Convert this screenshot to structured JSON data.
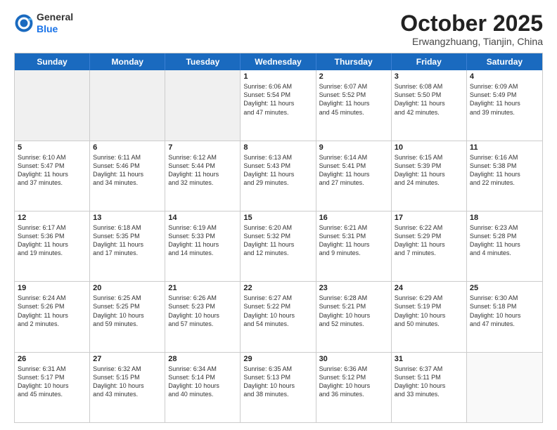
{
  "header": {
    "logo_general": "General",
    "logo_blue": "Blue",
    "month": "October 2025",
    "location": "Erwangzhuang, Tianjin, China"
  },
  "weekdays": [
    "Sunday",
    "Monday",
    "Tuesday",
    "Wednesday",
    "Thursday",
    "Friday",
    "Saturday"
  ],
  "rows": [
    [
      {
        "day": "",
        "lines": []
      },
      {
        "day": "",
        "lines": []
      },
      {
        "day": "",
        "lines": []
      },
      {
        "day": "1",
        "lines": [
          "Sunrise: 6:06 AM",
          "Sunset: 5:54 PM",
          "Daylight: 11 hours",
          "and 47 minutes."
        ]
      },
      {
        "day": "2",
        "lines": [
          "Sunrise: 6:07 AM",
          "Sunset: 5:52 PM",
          "Daylight: 11 hours",
          "and 45 minutes."
        ]
      },
      {
        "day": "3",
        "lines": [
          "Sunrise: 6:08 AM",
          "Sunset: 5:50 PM",
          "Daylight: 11 hours",
          "and 42 minutes."
        ]
      },
      {
        "day": "4",
        "lines": [
          "Sunrise: 6:09 AM",
          "Sunset: 5:49 PM",
          "Daylight: 11 hours",
          "and 39 minutes."
        ]
      }
    ],
    [
      {
        "day": "5",
        "lines": [
          "Sunrise: 6:10 AM",
          "Sunset: 5:47 PM",
          "Daylight: 11 hours",
          "and 37 minutes."
        ]
      },
      {
        "day": "6",
        "lines": [
          "Sunrise: 6:11 AM",
          "Sunset: 5:46 PM",
          "Daylight: 11 hours",
          "and 34 minutes."
        ]
      },
      {
        "day": "7",
        "lines": [
          "Sunrise: 6:12 AM",
          "Sunset: 5:44 PM",
          "Daylight: 11 hours",
          "and 32 minutes."
        ]
      },
      {
        "day": "8",
        "lines": [
          "Sunrise: 6:13 AM",
          "Sunset: 5:43 PM",
          "Daylight: 11 hours",
          "and 29 minutes."
        ]
      },
      {
        "day": "9",
        "lines": [
          "Sunrise: 6:14 AM",
          "Sunset: 5:41 PM",
          "Daylight: 11 hours",
          "and 27 minutes."
        ]
      },
      {
        "day": "10",
        "lines": [
          "Sunrise: 6:15 AM",
          "Sunset: 5:39 PM",
          "Daylight: 11 hours",
          "and 24 minutes."
        ]
      },
      {
        "day": "11",
        "lines": [
          "Sunrise: 6:16 AM",
          "Sunset: 5:38 PM",
          "Daylight: 11 hours",
          "and 22 minutes."
        ]
      }
    ],
    [
      {
        "day": "12",
        "lines": [
          "Sunrise: 6:17 AM",
          "Sunset: 5:36 PM",
          "Daylight: 11 hours",
          "and 19 minutes."
        ]
      },
      {
        "day": "13",
        "lines": [
          "Sunrise: 6:18 AM",
          "Sunset: 5:35 PM",
          "Daylight: 11 hours",
          "and 17 minutes."
        ]
      },
      {
        "day": "14",
        "lines": [
          "Sunrise: 6:19 AM",
          "Sunset: 5:33 PM",
          "Daylight: 11 hours",
          "and 14 minutes."
        ]
      },
      {
        "day": "15",
        "lines": [
          "Sunrise: 6:20 AM",
          "Sunset: 5:32 PM",
          "Daylight: 11 hours",
          "and 12 minutes."
        ]
      },
      {
        "day": "16",
        "lines": [
          "Sunrise: 6:21 AM",
          "Sunset: 5:31 PM",
          "Daylight: 11 hours",
          "and 9 minutes."
        ]
      },
      {
        "day": "17",
        "lines": [
          "Sunrise: 6:22 AM",
          "Sunset: 5:29 PM",
          "Daylight: 11 hours",
          "and 7 minutes."
        ]
      },
      {
        "day": "18",
        "lines": [
          "Sunrise: 6:23 AM",
          "Sunset: 5:28 PM",
          "Daylight: 11 hours",
          "and 4 minutes."
        ]
      }
    ],
    [
      {
        "day": "19",
        "lines": [
          "Sunrise: 6:24 AM",
          "Sunset: 5:26 PM",
          "Daylight: 11 hours",
          "and 2 minutes."
        ]
      },
      {
        "day": "20",
        "lines": [
          "Sunrise: 6:25 AM",
          "Sunset: 5:25 PM",
          "Daylight: 10 hours",
          "and 59 minutes."
        ]
      },
      {
        "day": "21",
        "lines": [
          "Sunrise: 6:26 AM",
          "Sunset: 5:23 PM",
          "Daylight: 10 hours",
          "and 57 minutes."
        ]
      },
      {
        "day": "22",
        "lines": [
          "Sunrise: 6:27 AM",
          "Sunset: 5:22 PM",
          "Daylight: 10 hours",
          "and 54 minutes."
        ]
      },
      {
        "day": "23",
        "lines": [
          "Sunrise: 6:28 AM",
          "Sunset: 5:21 PM",
          "Daylight: 10 hours",
          "and 52 minutes."
        ]
      },
      {
        "day": "24",
        "lines": [
          "Sunrise: 6:29 AM",
          "Sunset: 5:19 PM",
          "Daylight: 10 hours",
          "and 50 minutes."
        ]
      },
      {
        "day": "25",
        "lines": [
          "Sunrise: 6:30 AM",
          "Sunset: 5:18 PM",
          "Daylight: 10 hours",
          "and 47 minutes."
        ]
      }
    ],
    [
      {
        "day": "26",
        "lines": [
          "Sunrise: 6:31 AM",
          "Sunset: 5:17 PM",
          "Daylight: 10 hours",
          "and 45 minutes."
        ]
      },
      {
        "day": "27",
        "lines": [
          "Sunrise: 6:32 AM",
          "Sunset: 5:15 PM",
          "Daylight: 10 hours",
          "and 43 minutes."
        ]
      },
      {
        "day": "28",
        "lines": [
          "Sunrise: 6:34 AM",
          "Sunset: 5:14 PM",
          "Daylight: 10 hours",
          "and 40 minutes."
        ]
      },
      {
        "day": "29",
        "lines": [
          "Sunrise: 6:35 AM",
          "Sunset: 5:13 PM",
          "Daylight: 10 hours",
          "and 38 minutes."
        ]
      },
      {
        "day": "30",
        "lines": [
          "Sunrise: 6:36 AM",
          "Sunset: 5:12 PM",
          "Daylight: 10 hours",
          "and 36 minutes."
        ]
      },
      {
        "day": "31",
        "lines": [
          "Sunrise: 6:37 AM",
          "Sunset: 5:11 PM",
          "Daylight: 10 hours",
          "and 33 minutes."
        ]
      },
      {
        "day": "",
        "lines": []
      }
    ]
  ]
}
